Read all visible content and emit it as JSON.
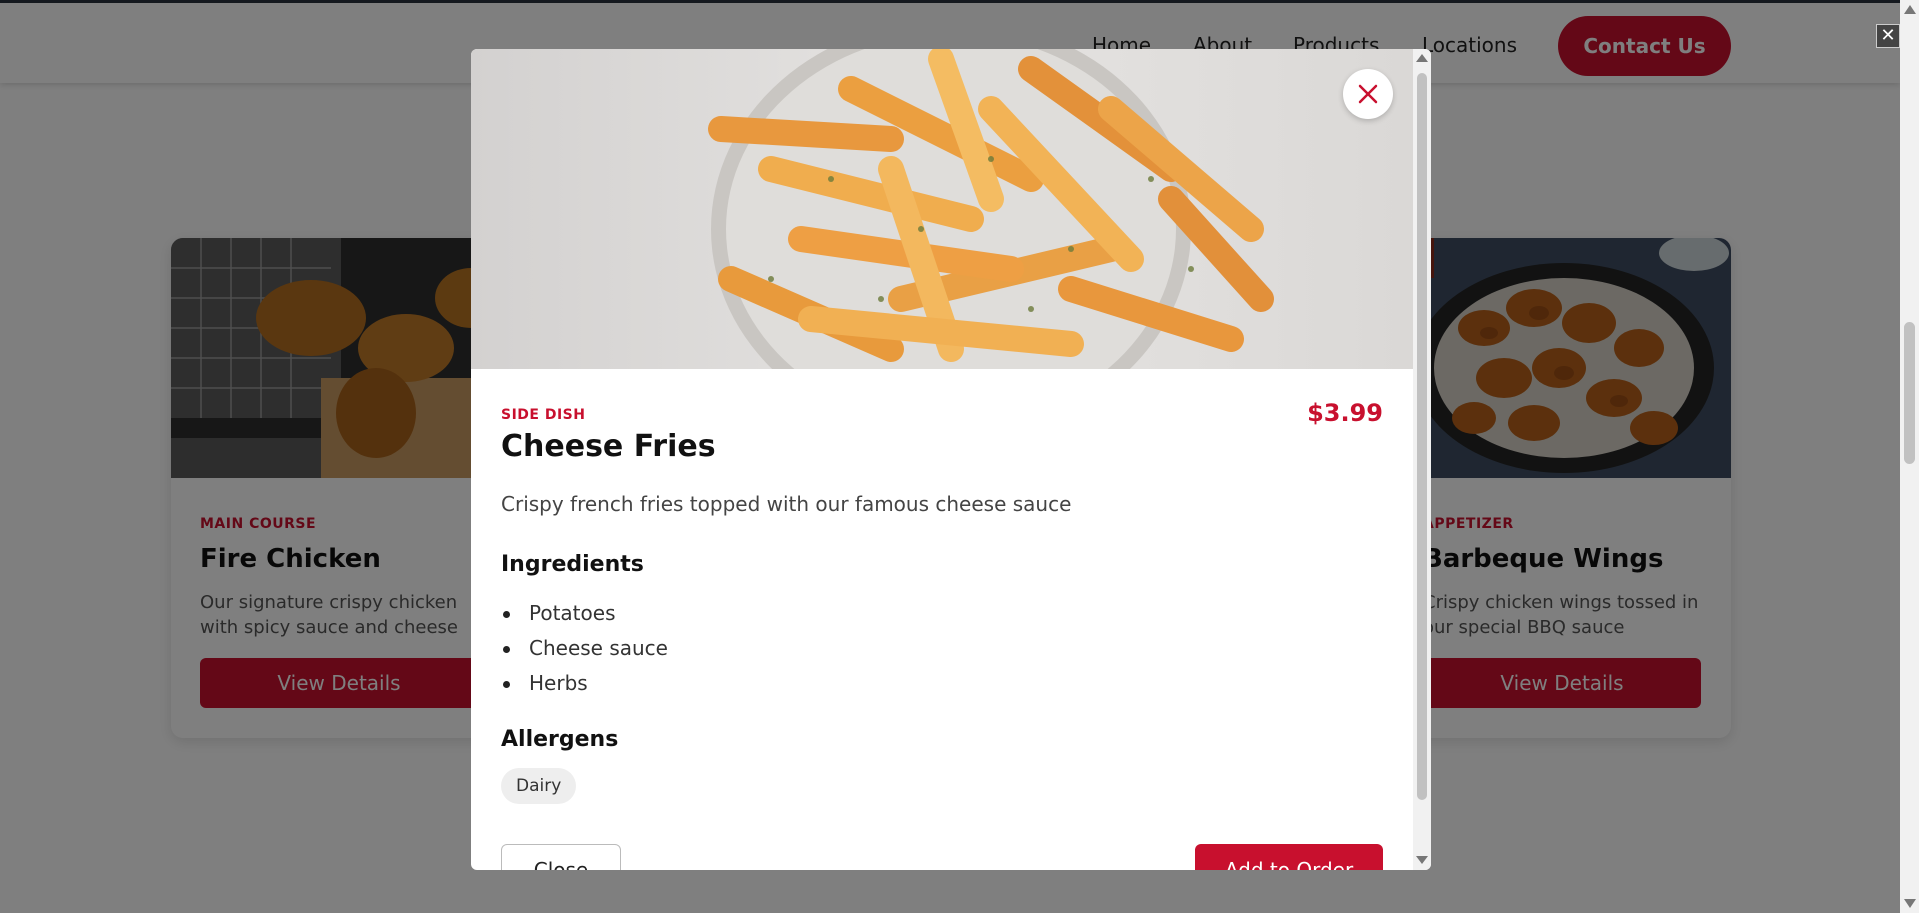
{
  "nav": {
    "links": [
      "Home",
      "About",
      "Products",
      "Locations"
    ],
    "contact_label": "Contact Us"
  },
  "cards": [
    {
      "category": "MAIN COURSE",
      "title": "Fire Chicken",
      "description": "Our signature crispy chicken with spicy sauce and cheese",
      "button": "View Details"
    },
    {
      "category": "APPETIZER",
      "title": "Barbeque Wings",
      "description": "Crispy chicken wings tossed in our special BBQ sauce",
      "button": "View Details"
    }
  ],
  "modal": {
    "category": "SIDE DISH",
    "title": "Cheese Fries",
    "price": "$3.99",
    "description": "Crispy french fries topped with our famous cheese sauce",
    "ingredients_heading": "Ingredients",
    "ingredients": [
      "Potatoes",
      "Cheese sauce",
      "Herbs"
    ],
    "allergens_heading": "Allergens",
    "allergens": [
      "Dairy"
    ],
    "close_label": "Close",
    "order_label": "Add to Order"
  },
  "colors": {
    "accent": "#c8102e",
    "overlay": "rgba(0,0,0,0.5)"
  },
  "icons": {
    "modal_close": "close-icon",
    "overlay_close": "close-icon"
  }
}
